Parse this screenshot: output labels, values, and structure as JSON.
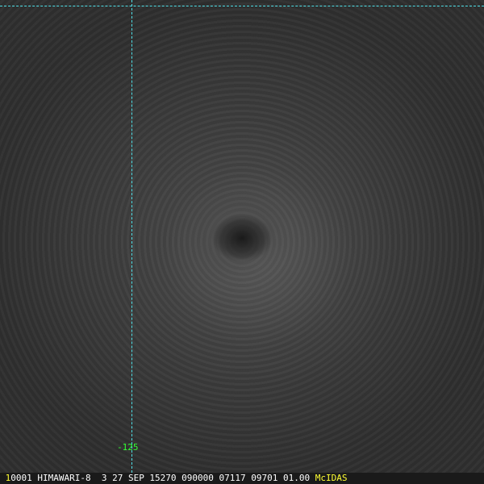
{
  "image": {
    "description_free": true
  },
  "overlay": {
    "longitude_label": "-125",
    "line_color": "#4fe0e8",
    "label_color": "#33ff33"
  },
  "status_bar": {
    "frame": "1",
    "text": "0001 HIMAWARI-8  3 27 SEP 15270 090000 07117 09701 01.00",
    "brand": "McIDAS",
    "brand_color": "#ffff33"
  }
}
